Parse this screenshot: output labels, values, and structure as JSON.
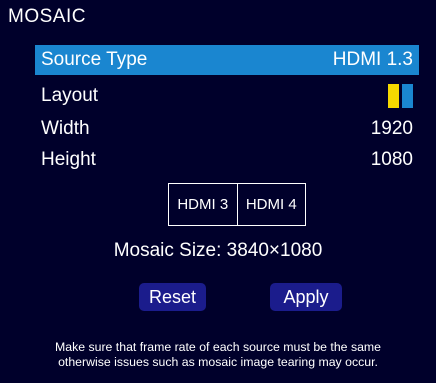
{
  "title": "MOSAIC",
  "rows": [
    {
      "label": "Source Type",
      "value": "HDMI 1.3",
      "selected": true
    },
    {
      "label": "Layout",
      "value": ""
    },
    {
      "label": "Width",
      "value": "1920"
    },
    {
      "label": "Height",
      "value": "1080"
    }
  ],
  "layout_colors": {
    "left": "#f5d800",
    "right": "#1a86d0"
  },
  "mosaic_cells": [
    "HDMI 3",
    "HDMI 4"
  ],
  "mosaic_size_text": "Mosaic Size: 3840×1080",
  "buttons": {
    "reset": "Reset",
    "apply": "Apply"
  },
  "note": {
    "line1": "Make sure that frame rate of each source must be the same",
    "line2": "otherwise issues such as mosaic image tearing may occur."
  },
  "colors": {
    "background": "#00002b",
    "selection": "#1a86d0",
    "button": "#1b1c8c",
    "text": "#ffffff"
  }
}
